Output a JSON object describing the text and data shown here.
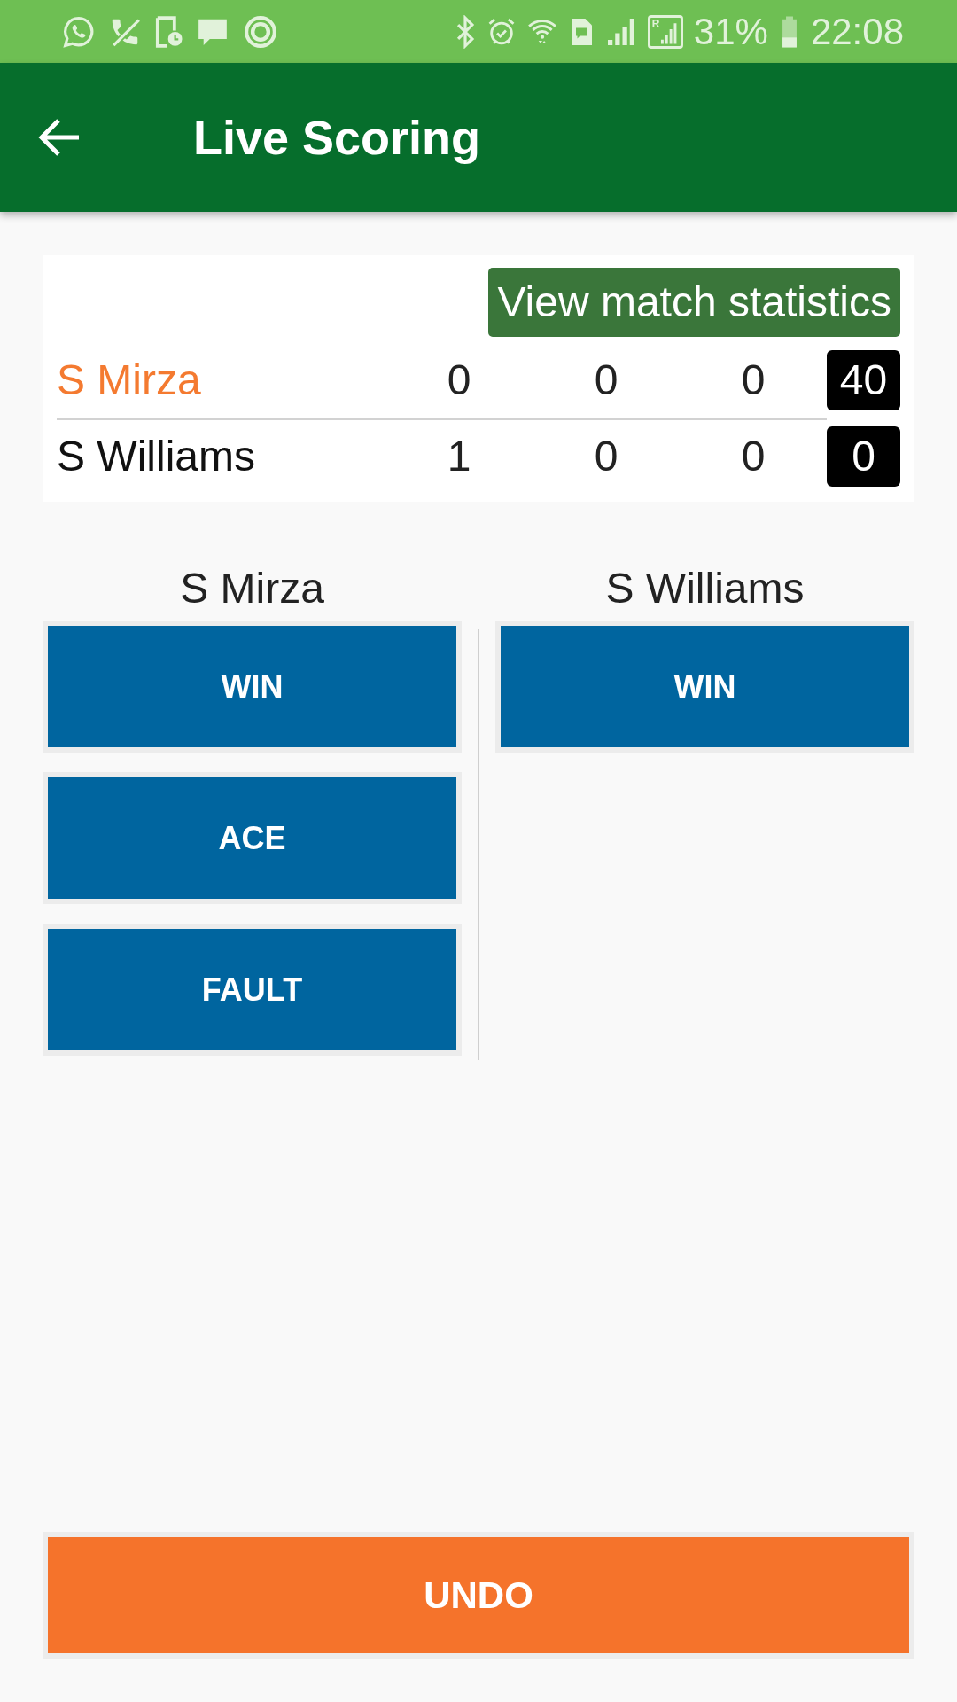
{
  "status_bar": {
    "roaming_mark": "R",
    "battery": "31%",
    "time": "22:08"
  },
  "app_bar": {
    "title": "Live Scoring"
  },
  "scoreboard": {
    "stats_button": "View match statistics",
    "players": [
      {
        "name": "S Mirza",
        "highlighted": true,
        "scores": [
          "0",
          "0",
          "0"
        ],
        "point": "40"
      },
      {
        "name": "S Williams",
        "highlighted": false,
        "scores": [
          "1",
          "0",
          "0"
        ],
        "point": "0"
      }
    ]
  },
  "action_columns": [
    {
      "player": "S Mirza",
      "buttons": [
        "WIN",
        "ACE",
        "FAULT"
      ]
    },
    {
      "player": "S Williams",
      "buttons": [
        "WIN"
      ]
    }
  ],
  "undo_button": "UNDO"
}
